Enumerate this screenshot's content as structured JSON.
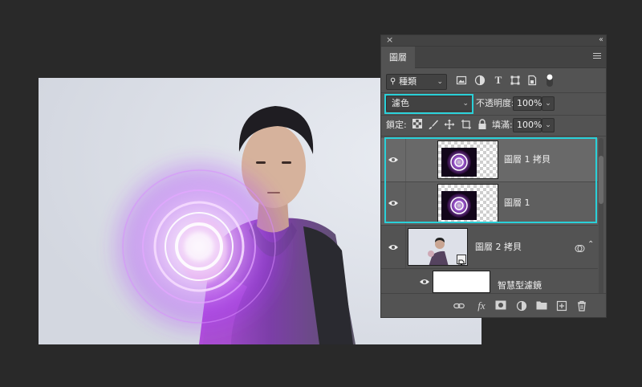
{
  "panel": {
    "title_tab": "圖層",
    "close_glyph": "×",
    "collapse_glyph": "‹‹"
  },
  "filter": {
    "kind_label": "種類",
    "icons": [
      "image-filter-icon",
      "adjustment-filter-icon",
      "type-filter-icon",
      "shape-filter-icon",
      "smart-object-filter-icon",
      "filter-toggle-icon"
    ]
  },
  "blend": {
    "mode": "濾色",
    "opacity_label": "不透明度:",
    "opacity_value": "100%"
  },
  "lock": {
    "label": "鎖定:",
    "fill_label": "填滿:",
    "fill_value": "100%"
  },
  "layers": [
    {
      "name": "圖層 1 拷貝",
      "visible": true,
      "selected": true,
      "type": "pixel"
    },
    {
      "name": "圖層 1",
      "visible": true,
      "selected": true,
      "type": "pixel"
    },
    {
      "name": "圖層 2 拷貝",
      "visible": true,
      "selected": false,
      "type": "smart-object"
    },
    {
      "name": "智慧型濾鏡",
      "visible": true,
      "selected": false,
      "type": "smart-filter"
    }
  ],
  "footer_icons": [
    "link-layers-icon",
    "fx-icon",
    "add-mask-icon",
    "new-adjustment-icon",
    "new-group-icon",
    "new-layer-icon",
    "delete-layer-icon"
  ],
  "footer_fx": "fx",
  "colors": {
    "highlight": "#2ad0d8",
    "panel_bg": "#535353",
    "app_bg": "#292929",
    "glow": "#b040ff"
  }
}
